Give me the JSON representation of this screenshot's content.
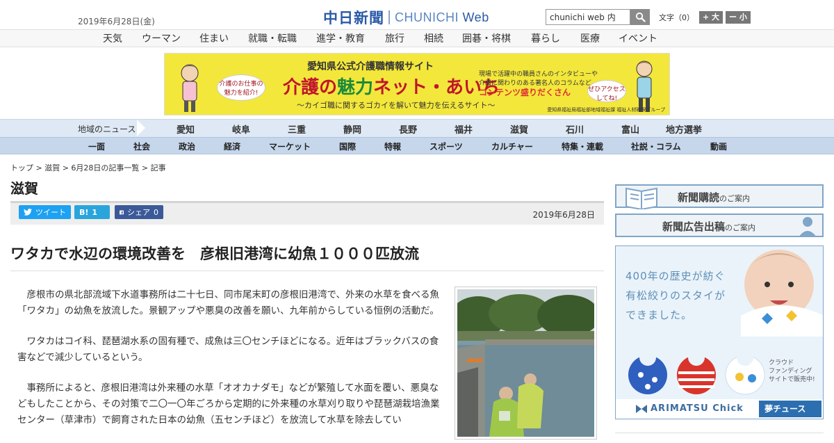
{
  "header": {
    "date": "2019年6月28日(金)",
    "logo_ja": "中日新聞",
    "logo_en_1": "CHUNICHI",
    "logo_en_2": "Web",
    "search_value": "chunichi web 内",
    "textsize_label": "文字（0）",
    "textsize_plus": "+ 大",
    "textsize_minus": "ー 小"
  },
  "category_nav": [
    "天気",
    "ウーマン",
    "住まい",
    "就職・転職",
    "進学・教育",
    "旅行",
    "相続",
    "囲碁・将棋",
    "暮らし",
    "医療",
    "イベント"
  ],
  "banner": {
    "subtitle": "愛知県公式介護職情報サイト",
    "title_a": "介護の",
    "title_b": "魅力",
    "title_c": "ネット",
    "title_d": "・あいち",
    "tagline": "〜カイゴ職に関するゴカイを解いて魅力を伝えるサイト〜",
    "bubble_left": "介護のお仕事の魅力を紹介!",
    "side_1": "現場で活躍中の職員さんのインタビューや",
    "side_2": "介護に関わりのある著名人のコラムなど",
    "side_3": "コンテンツ盛りだくさん",
    "bubble_right": "ぜひアクセスしてね!",
    "footer": "愛知県福祉局福祉部地域福祉課 福祉人材確保グループ"
  },
  "region_nav": {
    "head": "地域のニュース",
    "items": [
      "愛知",
      "岐阜",
      "三重",
      "静岡",
      "長野",
      "福井",
      "滋賀",
      "石川",
      "富山",
      "地方選挙"
    ]
  },
  "section_nav": [
    "一面",
    "社会",
    "政治",
    "経済",
    "マーケット",
    "国際",
    "特報",
    "スポーツ",
    "カルチャー",
    "特集・連載",
    "社説・コラム",
    "動画"
  ],
  "breadcrumb": "トップ > 滋賀 > 6月28日の記事一覧 > 記事",
  "prefecture": "滋賀",
  "share": {
    "tweet": "ツイート",
    "hatena_logo": "B!",
    "hatena_count": "1",
    "fb_label": "シェア",
    "fb_count": "0",
    "date": "2019年6月28日"
  },
  "article": {
    "headline": "ワタカで水辺の環境改善を　彦根旧港湾に幼魚１０００匹放流",
    "paragraphs": [
      "彦根市の県北部流域下水道事務所は二十七日、同市尾末町の彦根旧港湾で、外来の水草を食べる魚「ワタカ」の幼魚を放流した。景観アップや悪臭の改善を願い、九年前からしている恒例の活動だ。",
      "ワタカはコイ科、琵琶湖水系の固有種で、成魚は三〇センチほどになる。近年はブラックバスの食害などで減少しているという。",
      "事務所によると、彦根旧港湾は外来種の水草「オオカナダモ」などが繁殖して水面を覆い、悪臭などもしたことから、その対策で二〇一〇年ごろから定期的に外来種の水草刈り取りや琵琶湖栽培漁業センター（草津市）で飼育された日本の幼魚（五センチほど）を放流して水草を除去してい"
    ]
  },
  "sidebar": {
    "subscribe_main": "新聞購読",
    "subscribe_sub": "のご案内",
    "ad_main": "新聞広告出稿",
    "ad_sub": "のご案内",
    "ad2_line1": "400年の歴史が紡ぐ",
    "ad2_line2": "有松絞りのスタイが",
    "ad2_line3": "できました。",
    "ad2_crowd_1": "クラウド",
    "ad2_crowd_2": "ファンディング",
    "ad2_crowd_3": "サイトで販売中!",
    "ad2_brand": "ARIMATSU Chick",
    "ad2_mark": "夢チュース"
  },
  "colors": {
    "brand_blue": "#2a5aa8",
    "region_bg": "#dfe9f5",
    "section_bg": "#c6d7ec",
    "banner_yellow": "#f3e73b",
    "twitter": "#1da1f2",
    "hatena": "#29a5dc",
    "facebook": "#3b5998"
  }
}
